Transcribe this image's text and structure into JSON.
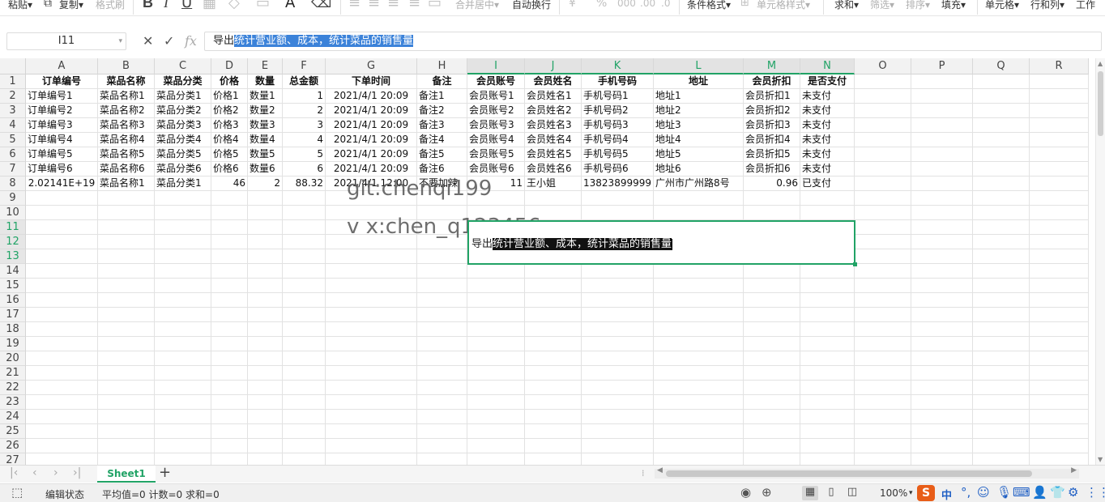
{
  "toolbar": {
    "paste": "粘贴▾",
    "copy": "复制▾",
    "format_painter": "格式刷",
    "bold": "B",
    "italic": "I",
    "underline": "U",
    "font_color": "A",
    "merge_center": "合并居中▾",
    "wrap_text": "自动换行",
    "currency": "¥",
    "percent": "%",
    "conditional_format": "条件格式▾",
    "cell_style": "单元格样式▾",
    "sum": "求和▾",
    "filter": "筛选▾",
    "sort": "排序▾",
    "fill": "填充▾",
    "cell": "单元格▾",
    "row_col": "行和列▾",
    "worksheet": "工作"
  },
  "formula_bar": {
    "name_box": "I11",
    "cancel_icon": "✕",
    "confirm_icon": "✓",
    "fx_label": "fx",
    "content_prefix": "导出",
    "content_selected": "统计营业额、成本，统计菜品的销售量"
  },
  "columns": [
    "A",
    "B",
    "C",
    "D",
    "E",
    "F",
    "G",
    "H",
    "I",
    "J",
    "K",
    "L",
    "M",
    "N",
    "O",
    "P",
    "Q",
    "R"
  ],
  "rows": [
    "1",
    "2",
    "3",
    "4",
    "5",
    "6",
    "7",
    "8",
    "9",
    "10",
    "11",
    "12",
    "13",
    "14",
    "15",
    "16",
    "17",
    "18",
    "19",
    "20",
    "21",
    "22",
    "23",
    "24",
    "25",
    "26",
    "27"
  ],
  "table": {
    "headers": [
      "订单编号",
      "菜品名称",
      "菜品分类",
      "价格",
      "数量",
      "总金额",
      "下单时间",
      "备注",
      "会员账号",
      "会员姓名",
      "手机号码",
      "地址",
      "会员折扣",
      "是否支付"
    ],
    "rows": [
      [
        "订单编号1",
        "菜品名称1",
        "菜品分类1",
        "价格1",
        "数量1",
        "1",
        "2021/4/1 20:09",
        "备注1",
        "会员账号1",
        "会员姓名1",
        "手机号码1",
        "地址1",
        "会员折扣1",
        "未支付"
      ],
      [
        "订单编号2",
        "菜品名称2",
        "菜品分类2",
        "价格2",
        "数量2",
        "2",
        "2021/4/1 20:09",
        "备注2",
        "会员账号2",
        "会员姓名2",
        "手机号码2",
        "地址2",
        "会员折扣2",
        "未支付"
      ],
      [
        "订单编号3",
        "菜品名称3",
        "菜品分类3",
        "价格3",
        "数量3",
        "3",
        "2021/4/1 20:09",
        "备注3",
        "会员账号3",
        "会员姓名3",
        "手机号码3",
        "地址3",
        "会员折扣3",
        "未支付"
      ],
      [
        "订单编号4",
        "菜品名称4",
        "菜品分类4",
        "价格4",
        "数量4",
        "4",
        "2021/4/1 20:09",
        "备注4",
        "会员账号4",
        "会员姓名4",
        "手机号码4",
        "地址4",
        "会员折扣4",
        "未支付"
      ],
      [
        "订单编号5",
        "菜品名称5",
        "菜品分类5",
        "价格5",
        "数量5",
        "5",
        "2021/4/1 20:09",
        "备注5",
        "会员账号5",
        "会员姓名5",
        "手机号码5",
        "地址5",
        "会员折扣5",
        "未支付"
      ],
      [
        "订单编号6",
        "菜品名称6",
        "菜品分类6",
        "价格6",
        "数量6",
        "6",
        "2021/4/1 20:09",
        "备注6",
        "会员账号6",
        "会员姓名6",
        "手机号码6",
        "地址6",
        "会员折扣6",
        "未支付"
      ],
      [
        "2.02141E+19",
        "菜品名称1",
        "菜品分类1",
        "46",
        "2",
        "88.32",
        "2021/4/1 12:00",
        "不要加辣",
        "11",
        "王小姐",
        "13823899999",
        "广州市广州路8号",
        "0.96",
        "已支付"
      ]
    ]
  },
  "merged_cell": {
    "prefix": "导出",
    "selected": "统计营业额、成本，统计菜品的销售量"
  },
  "watermark": {
    "line1": "git:chenqi199",
    "line2": "v x:chen_q123456"
  },
  "sheet_tabs": {
    "active": "Sheet1",
    "add": "+"
  },
  "status_bar": {
    "mode": "编辑状态",
    "stats": "平均值=0  计数=0  求和=0",
    "zoom": "100%",
    "ime_lang": "中"
  },
  "colors": {
    "accent": "#21a366",
    "selection": "#3b82d9",
    "sogou": "#e85d18"
  }
}
